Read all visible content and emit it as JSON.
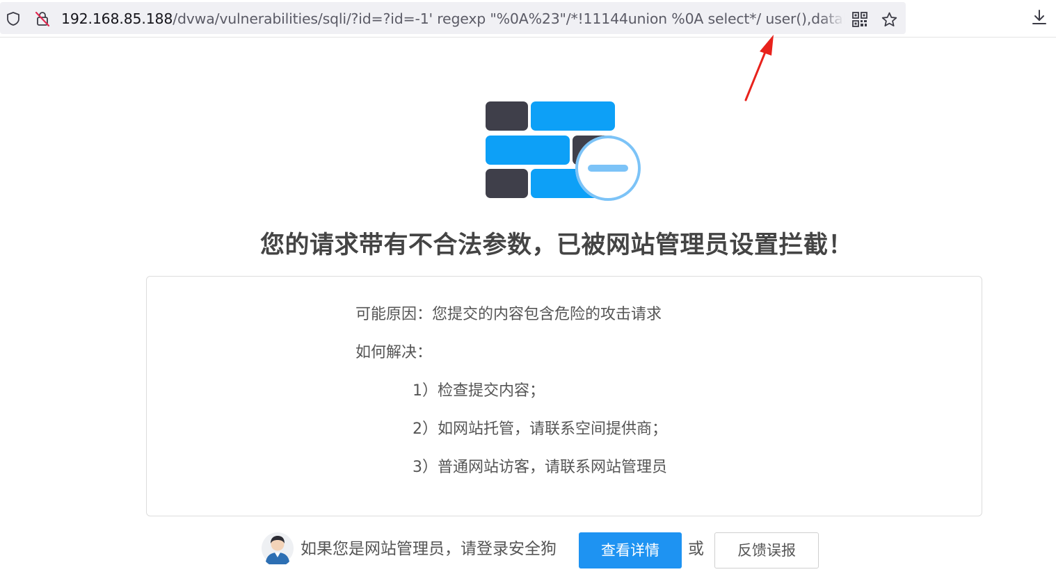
{
  "browser": {
    "url_host": "192.168.85.188",
    "url_path": "/dvwa/vulnerabilities/sqli/?id=?id=-1' regexp \"%0A%23\"/*!11144union %0A select*/ user(),database()",
    "icons": {
      "shield": "shield-icon",
      "insecure_lock": "insecure-lock-icon",
      "qr": "qr-code-icon",
      "bookmark": "star-icon",
      "download": "download-icon"
    }
  },
  "block_page": {
    "title": "您的请求带有不合法参数，已被网站管理员设置拦截！",
    "reason": "可能原因：您提交的内容包含危险的攻击请求",
    "how_to_fix": "如何解决：",
    "steps": [
      "1）检查提交内容；",
      "2）如网站托管，请联系空间提供商；",
      "3）普通网站访客，请联系网站管理员"
    ],
    "footer": {
      "admin_prompt": "如果您是网站管理员，请登录安全狗",
      "details_button": "查看详情",
      "or": "或",
      "feedback_button": "反馈误报"
    }
  },
  "colors": {
    "accent_blue": "#1e93f2",
    "brick_blue": "#0da0f7",
    "brick_dark": "#3f3f4a",
    "annotation_red": "#e8221c"
  }
}
